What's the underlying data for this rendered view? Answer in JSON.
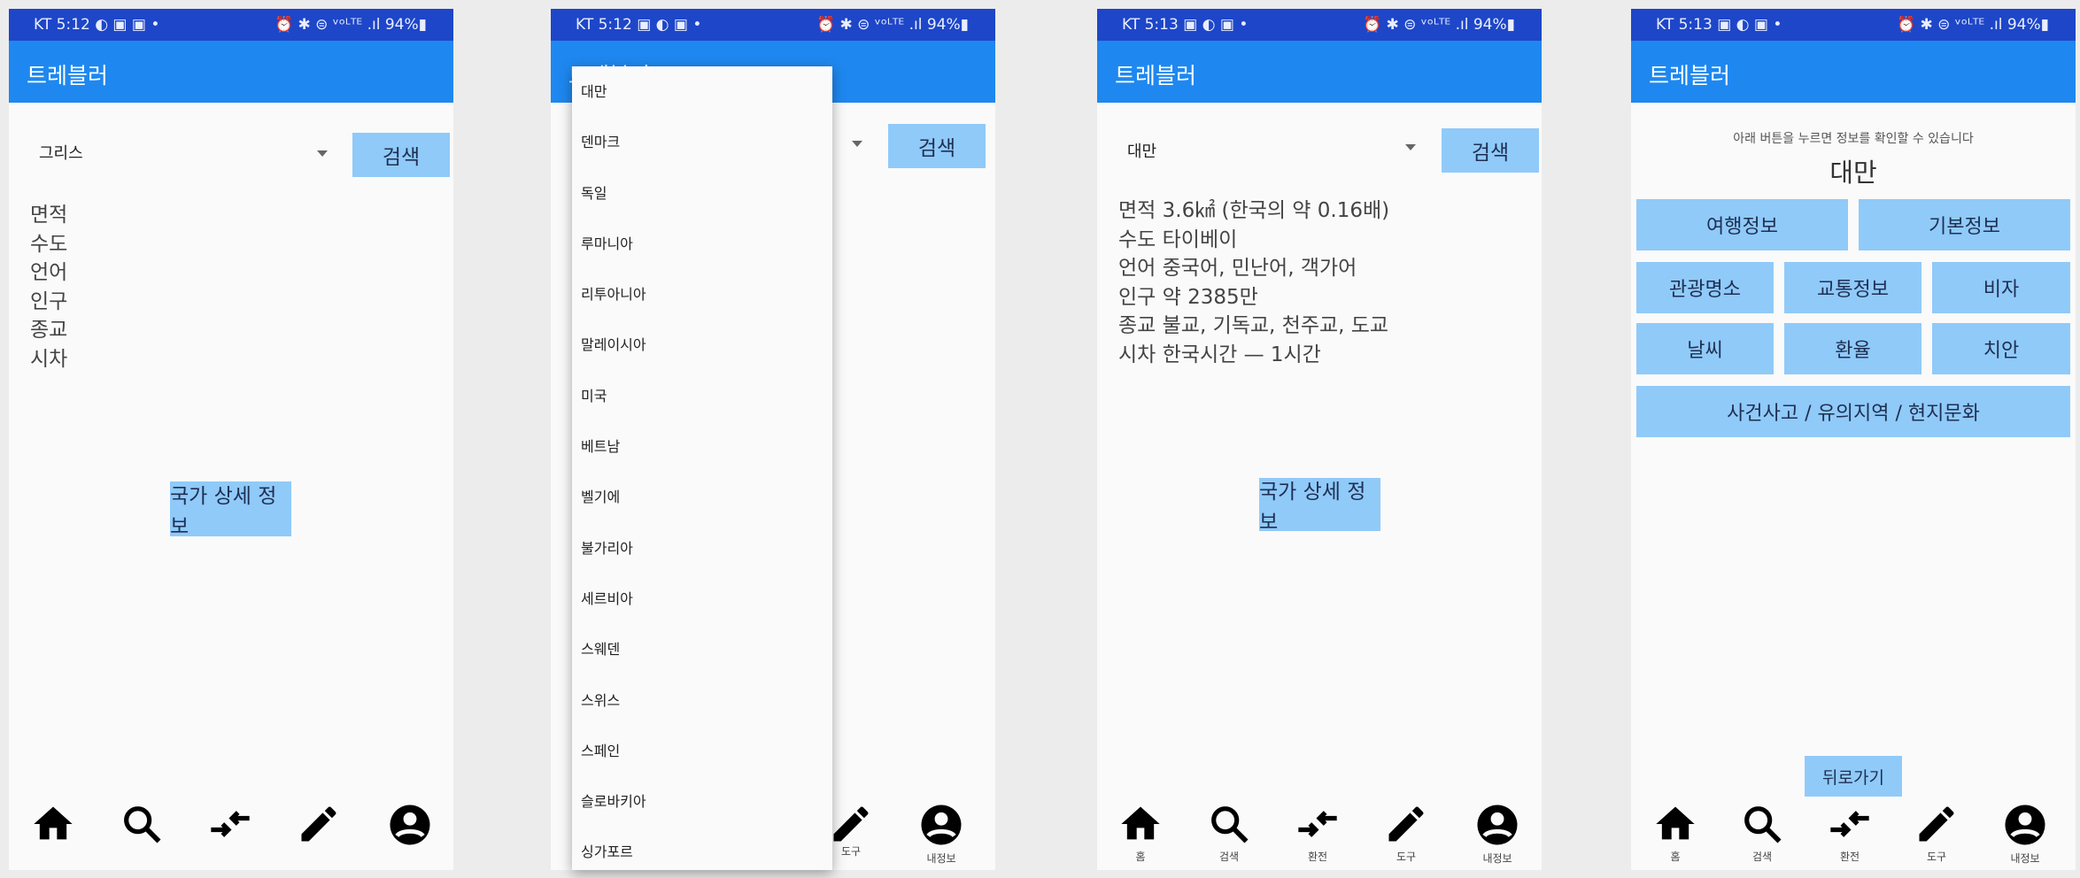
{
  "status_bar": {
    "s1": {
      "left": "KT 5:12 ◐ ▣ ▣ •",
      "right": "⏰ ✱ ⊜ ᵛᵒᴸᵀᴱ .ıl 94%▮"
    },
    "s2": {
      "left": "KT 5:12 ▣ ◐ ▣ •",
      "right": "⏰ ✱ ⊜ ᵛᵒᴸᵀᴱ .ıl 94%▮"
    },
    "s3": {
      "left": "KT 5:13 ▣ ◐ ▣ •",
      "right": "⏰ ✱ ⊜ ᵛᵒᴸᵀᴱ .ıl 94%▮"
    },
    "s4": {
      "left": "KT 5:13 ▣ ◐ ▣ •",
      "right": "⏰ ✱ ⊜ ᵛᵒᴸᵀᴱ .ıl 94%▮"
    }
  },
  "app_title": "트레블러",
  "screen1": {
    "selected_country": "그리스",
    "search_label": "검색",
    "info_labels": [
      "면적",
      "수도",
      "언어",
      "인구",
      "종교",
      "시차"
    ],
    "detail_button": "국가 상세 정보"
  },
  "screen2": {
    "search_label": "검색",
    "countries": [
      "대만",
      "덴마크",
      "독일",
      "루마니아",
      "리투아니아",
      "말레이시아",
      "미국",
      "베트남",
      "벨기에",
      "불가리아",
      "세르비아",
      "스웨덴",
      "스위스",
      "스페인",
      "슬로바키아",
      "싱가포르"
    ],
    "nav_labels_visible": [
      "도구",
      "내정보"
    ]
  },
  "screen3": {
    "selected_country": "대만",
    "search_label": "검색",
    "info_rows": [
      "면적  3.6㎢ (한국의 약 0.16배)",
      "수도  타이베이",
      "언어  중국어, 민난어, 객가어",
      "인구  약 2385만",
      "종교  불교, 기독교, 천주교, 도교",
      "시차  한국시간 — 1시간"
    ],
    "detail_button": "국가 상세 정보"
  },
  "screen4": {
    "hint": "아래 버튼을 누르면 정보를 확인할 수 있습니다",
    "country": "대만",
    "buttons_row1": [
      "여행정보",
      "기본정보"
    ],
    "buttons_row2": [
      "관광명소",
      "교통정보",
      "비자"
    ],
    "buttons_row3": [
      "날씨",
      "환율",
      "치안"
    ],
    "wide_button": "사건사고 / 유의지역 / 현지문화",
    "back_button": "뒤로가기"
  },
  "nav": {
    "labels": [
      "홈",
      "검색",
      "환전",
      "도구",
      "내정보"
    ]
  },
  "colors": {
    "status": "#1e46c8",
    "appbar": "#1e88f0",
    "button": "#90caf9"
  }
}
